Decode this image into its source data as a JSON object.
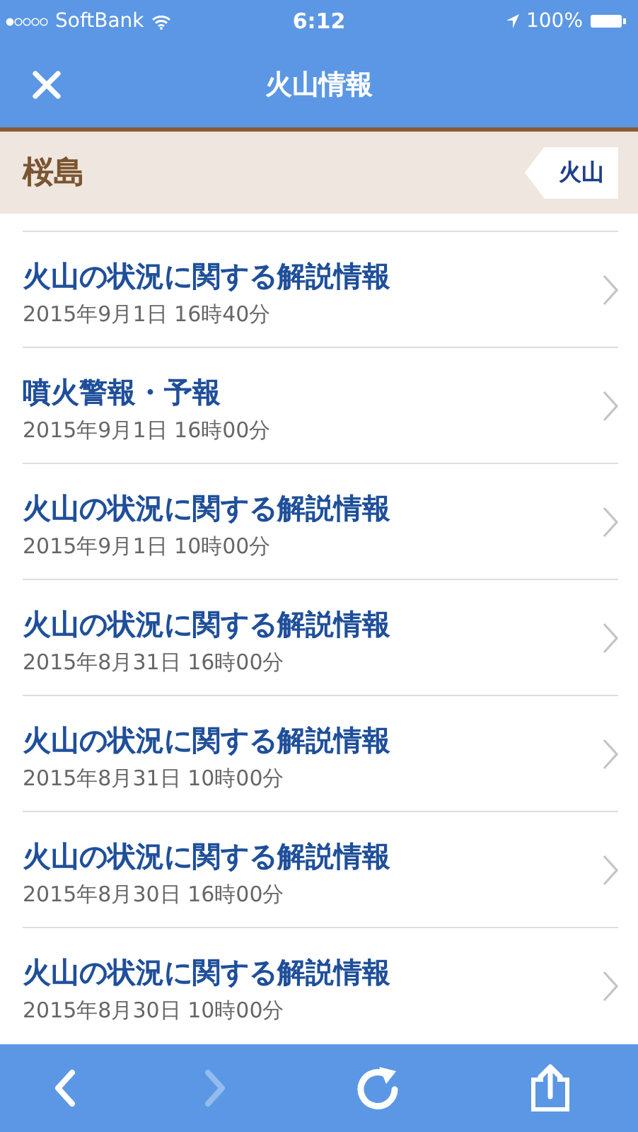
{
  "status_bar": {
    "carrier": "SoftBank",
    "time": "6:12",
    "battery": "100%"
  },
  "nav_bar": {
    "title": "火山情報"
  },
  "section": {
    "title": "桜島",
    "tag": "火山"
  },
  "items": [
    {
      "title": "火山の状況に関する解説情報",
      "date": "2015年9月1日 16時40分"
    },
    {
      "title": "噴火警報・予報",
      "date": "2015年9月1日 16時00分"
    },
    {
      "title": "火山の状況に関する解説情報",
      "date": "2015年9月1日 10時00分"
    },
    {
      "title": "火山の状況に関する解説情報",
      "date": "2015年8月31日 16時00分"
    },
    {
      "title": "火山の状況に関する解説情報",
      "date": "2015年8月31日 10時00分"
    },
    {
      "title": "火山の状況に関する解説情報",
      "date": "2015年8月30日 16時00分"
    },
    {
      "title": "火山の状況に関する解説情報",
      "date": "2015年8月30日 10時00分"
    }
  ],
  "toolbar": {
    "back_disabled": false,
    "forward_disabled": true
  }
}
